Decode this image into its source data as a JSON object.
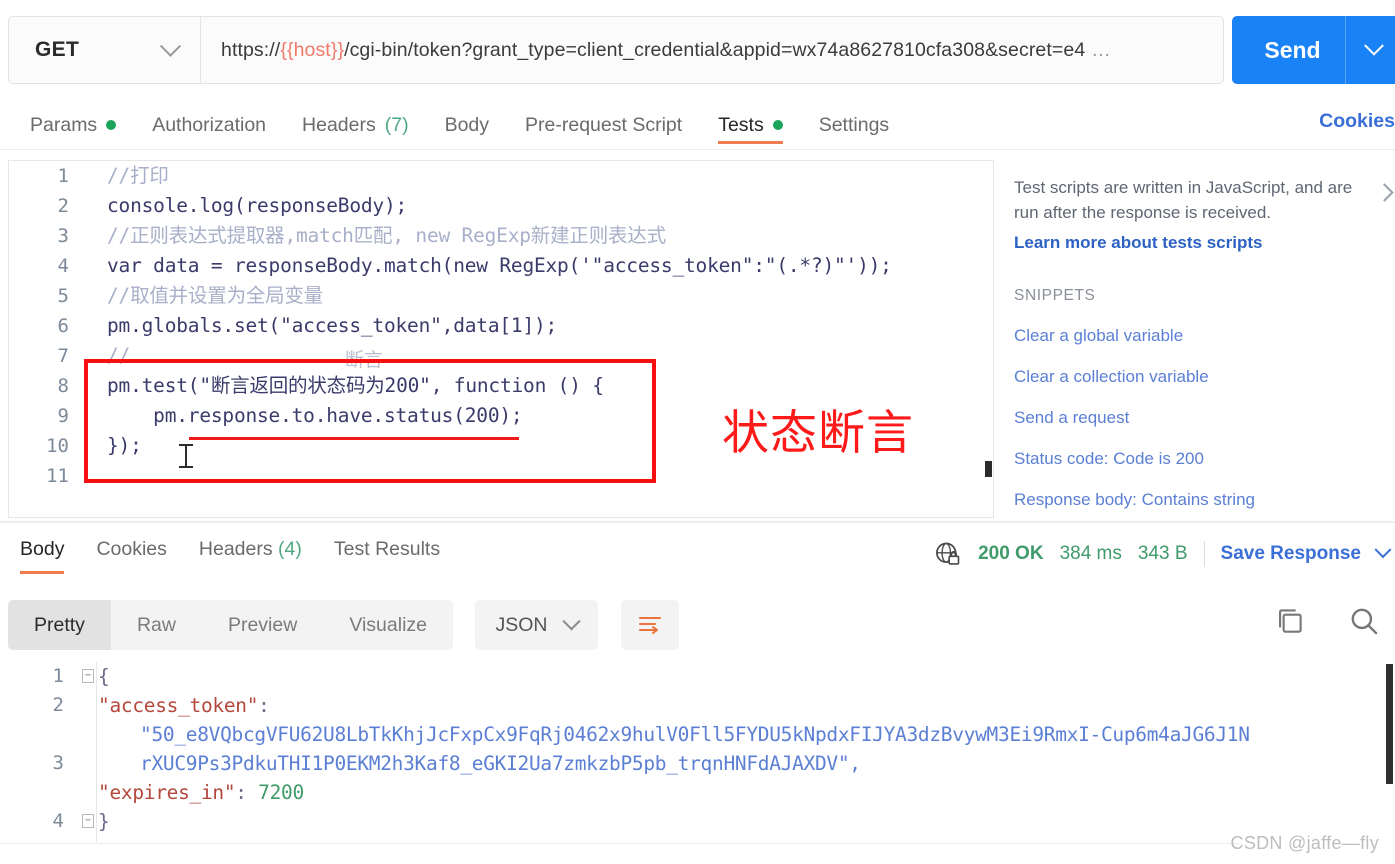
{
  "request": {
    "method": "GET",
    "url_prefix": "https://",
    "url_variable": "{{host}}",
    "url_suffix": "/cgi-bin/token?grant_type=client_credential&appid=wx74a8627810cfa308&secret=e4",
    "url_ellipsis": "…",
    "send_label": "Send",
    "tabs": [
      {
        "label": "Params",
        "dot": true,
        "active": false
      },
      {
        "label": "Authorization",
        "dot": false,
        "active": false
      },
      {
        "label": "Headers",
        "count": "(7)",
        "dot": false,
        "active": false
      },
      {
        "label": "Body",
        "dot": false,
        "active": false
      },
      {
        "label": "Pre-request Script",
        "dot": false,
        "active": false
      },
      {
        "label": "Tests",
        "dot": true,
        "active": true
      },
      {
        "label": "Settings",
        "dot": false,
        "active": false
      }
    ],
    "cookies_link": "Cookies"
  },
  "editor": {
    "line_numbers": [
      "1",
      "2",
      "3",
      "4",
      "5",
      "6",
      "7",
      "8",
      "9",
      "10",
      "11"
    ],
    "lines": [
      {
        "n": 1,
        "text": "//打印"
      },
      {
        "n": 2,
        "text": "console.log(responseBody);"
      },
      {
        "n": 3,
        "text": "//正则表达式提取器,match匹配, new RegExp新建正则表达式"
      },
      {
        "n": 4,
        "text": "var data = responseBody.match(new RegExp('\"access_token\":\"(.*?)\"'));"
      },
      {
        "n": 5,
        "text": "//取值并设置为全局变量"
      },
      {
        "n": 6,
        "text": "pm.globals.set(\"access_token\",data[1]);"
      },
      {
        "n": 7,
        "text": "//"
      },
      {
        "n": 8,
        "text": "pm.test(\"断言返回的状态码为200\", function () {"
      },
      {
        "n": 9,
        "text": "    pm.response.to.have.status(200);"
      },
      {
        "n": 10,
        "text": "});"
      },
      {
        "n": 11,
        "text": ""
      }
    ],
    "annotation": "状态断言",
    "annotation_color": "#ff1a1a",
    "highlight_box_color": "#f80f0f",
    "line7_overlay": "断言"
  },
  "snippets": {
    "intro": "Test scripts are written in JavaScript, and are run after the response is received.",
    "learn_more": "Learn more about tests scripts",
    "heading": "SNIPPETS",
    "items": [
      "Clear a global variable",
      "Clear a collection variable",
      "Send a request",
      "Status code: Code is 200",
      "Response body: Contains string"
    ]
  },
  "response": {
    "tabs": [
      {
        "label": "Body",
        "active": true
      },
      {
        "label": "Cookies",
        "active": false
      },
      {
        "label": "Headers",
        "count": "(4)",
        "active": false
      },
      {
        "label": "Test Results",
        "active": false
      }
    ],
    "status": "200 OK",
    "time": "384 ms",
    "size": "343 B",
    "save_label": "Save Response",
    "format_buttons": [
      {
        "label": "Pretty",
        "active": true
      },
      {
        "label": "Raw",
        "active": false
      },
      {
        "label": "Preview",
        "active": false
      },
      {
        "label": "Visualize",
        "active": false
      }
    ],
    "language": "JSON",
    "body_line_numbers": [
      "1",
      "2",
      "3",
      "4"
    ],
    "body": {
      "open_brace": "{",
      "key_token": "\"access_token\"",
      "colon": ":",
      "token_value_line1": "\"50_e8VQbcgVFU62U8LbTkKhjJcFxpCx9FqRj0462x9hulV0Fll5FYDU5kNpdxFIJYA3dzBvywM3Ei9RmxI-Cup6m4aJG6J1N",
      "token_value_line2": "rXUC9Ps3PdkuTHI1P0EKM2h3Kaf8_eGKI2Ua7zmkzbP5pb_trqnHNFdAJAXDV\",",
      "key_expires": "\"expires_in\"",
      "expires_value": "7200",
      "close_brace": "}"
    }
  },
  "watermark": "CSDN @jaffe—fly"
}
